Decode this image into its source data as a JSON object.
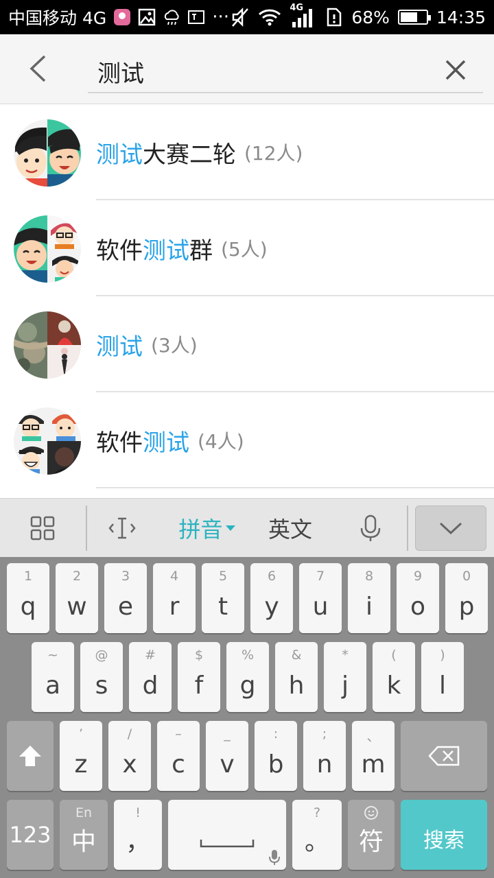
{
  "status_bar": {
    "carrier": "中国移动 4G",
    "network_small": "4G",
    "battery": "68%",
    "battery_level": 0.68,
    "time": "14:35"
  },
  "search": {
    "query": "测试"
  },
  "results": [
    {
      "pre": "",
      "hl": "测试",
      "post": "大赛二轮",
      "count": "(12人)"
    },
    {
      "pre": "软件",
      "hl": "测试",
      "post": "群",
      "count": "(5人)"
    },
    {
      "pre": "",
      "hl": "测试",
      "post": "",
      "count": "(3人)"
    },
    {
      "pre": "软件",
      "hl": "测试",
      "post": "",
      "count": "(4人)"
    }
  ],
  "ime_toolbar": {
    "pinyin": "拼音",
    "english": "英文"
  },
  "keyboard": {
    "row1": [
      {
        "sub": "1",
        "main": "q"
      },
      {
        "sub": "2",
        "main": "w"
      },
      {
        "sub": "3",
        "main": "e"
      },
      {
        "sub": "4",
        "main": "r"
      },
      {
        "sub": "5",
        "main": "t"
      },
      {
        "sub": "6",
        "main": "y"
      },
      {
        "sub": "7",
        "main": "u"
      },
      {
        "sub": "8",
        "main": "i"
      },
      {
        "sub": "9",
        "main": "o"
      },
      {
        "sub": "0",
        "main": "p"
      }
    ],
    "row2": [
      {
        "sub": "~",
        "main": "a"
      },
      {
        "sub": "@",
        "main": "s"
      },
      {
        "sub": "#",
        "main": "d"
      },
      {
        "sub": "$",
        "main": "f"
      },
      {
        "sub": "%",
        "main": "g"
      },
      {
        "sub": "&",
        "main": "h"
      },
      {
        "sub": "*",
        "main": "j"
      },
      {
        "sub": "(",
        "main": "k"
      },
      {
        "sub": ")",
        "main": "l"
      }
    ],
    "row3": [
      {
        "sub": "’",
        "main": "z"
      },
      {
        "sub": "/",
        "main": "x"
      },
      {
        "sub": "–",
        "main": "c"
      },
      {
        "sub": "_",
        "main": "v"
      },
      {
        "sub": ":",
        "main": "b"
      },
      {
        "sub": ";",
        "main": "n"
      },
      {
        "sub": "、",
        "main": "m"
      }
    ],
    "num_label": "123",
    "lang_sub": "En",
    "lang_main": "中",
    "comma_sub": "!",
    "comma_main": "，",
    "period_sub": "?",
    "period_main": "。",
    "symbol_label": "符",
    "search_label": "搜索"
  }
}
